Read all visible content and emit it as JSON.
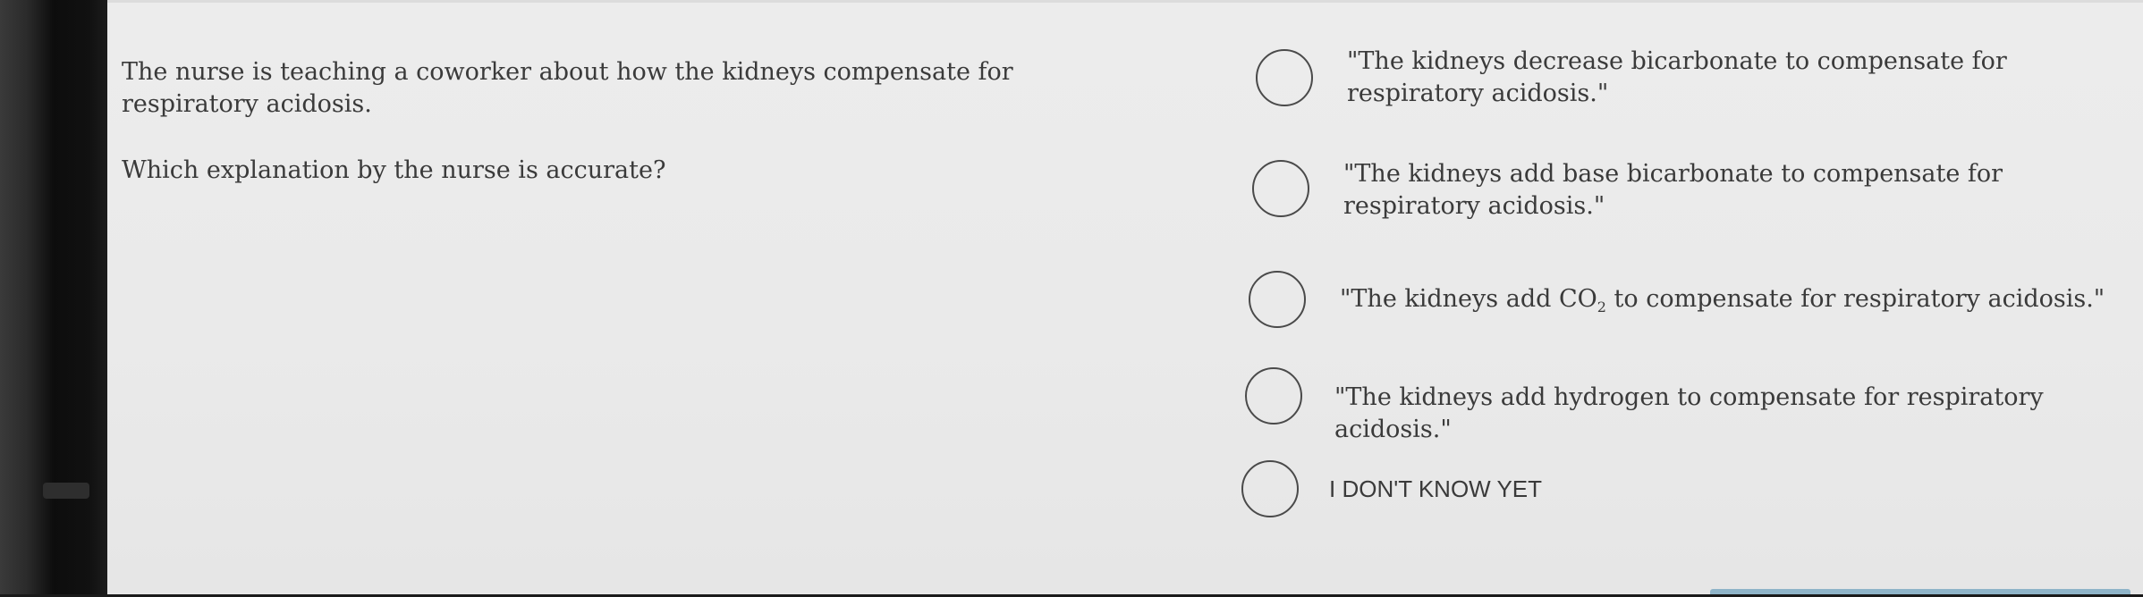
{
  "question": {
    "stem": "The nurse is teaching a coworker about how the kidneys compensate for respiratory acidosis.",
    "prompt": "Which explanation by the nurse is accurate?"
  },
  "options": [
    {
      "text": "\"The kidneys decrease bicarbonate to compensate for respiratory acidosis.\"",
      "selected": false
    },
    {
      "text": "\"The kidneys add base bicarbonate to compensate for respiratory acidosis.\"",
      "selected": false
    },
    {
      "text_before": "\"The kidneys add CO",
      "subscript": "2",
      "text_after": " to compensate for respiratory acidosis.\"",
      "selected": false
    },
    {
      "text": "\"The kidneys add hydrogen to compensate for respiratory acidosis.\"",
      "selected": false
    },
    {
      "text": "I DON'T KNOW YET",
      "selected": false
    }
  ],
  "colors": {
    "screen_background": "#ececec",
    "text": "#3a3a3a",
    "radio_border": "#4a4a4a",
    "bezel": "#111111"
  }
}
